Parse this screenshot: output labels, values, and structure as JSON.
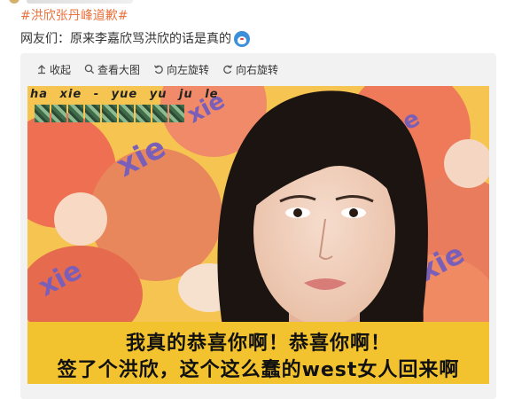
{
  "post": {
    "hashtag": "#洪欣张丹峰道歉#",
    "text": "网友们：原来李嘉欣骂洪欣的话是真的",
    "emoji": "doraemon-emoji-icon"
  },
  "toolbar": {
    "items": [
      {
        "label": "收起",
        "icon": "collapse-icon"
      },
      {
        "label": "查看大图",
        "icon": "search-icon"
      },
      {
        "label": "向左旋转",
        "icon": "rotate-left-icon"
      },
      {
        "label": "向右旋转",
        "icon": "rotate-right-icon"
      }
    ]
  },
  "image": {
    "top_caption": "ha xie - yue yu ju le",
    "tile_word": "xie",
    "subtitle_line1": "我真的恭喜你啊！恭喜你啊！",
    "subtitle_line2": "签了个洪欣，这个这么蠢的west女人回来啊"
  },
  "colors": {
    "hashtag": "#eb7340",
    "text": "#333333",
    "card_bg": "#f2f2f2",
    "subtitle_band": "#f2c22f",
    "emoji_blue": "#3c8fd9"
  }
}
